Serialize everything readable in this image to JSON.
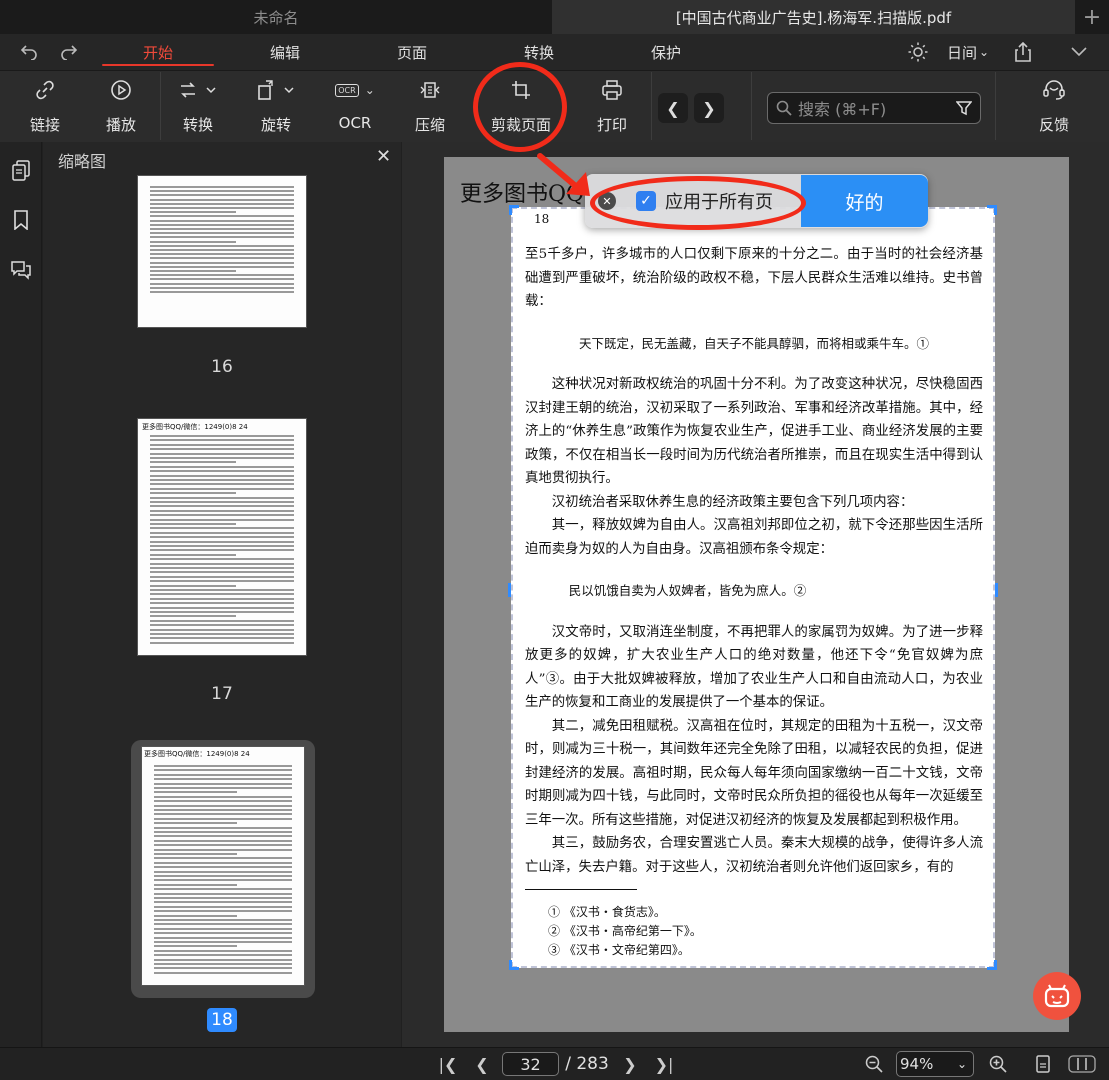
{
  "tabs": [
    {
      "label": "未命名"
    },
    {
      "label": "[中国古代商业广告史].杨海军.扫描版.pdf"
    }
  ],
  "tab_add": "+",
  "menu": {
    "start": "开始",
    "edit": "编辑",
    "page": "页面",
    "convert": "转换",
    "protect": "保护",
    "theme": "日间"
  },
  "toolbar": {
    "link": "链接",
    "play": "播放",
    "rotate_convert": "转换",
    "rotate": "旋转",
    "ocr": "OCR",
    "compress": "压缩",
    "crop": "剪裁页面",
    "print": "打印",
    "feedback": "反馈",
    "ocr_icon_text": "OCR",
    "search_placeholder": "搜索 (⌘+F)"
  },
  "sidebar": {
    "title": "缩略图",
    "close": "✕"
  },
  "thumbnails": [
    {
      "page": "16",
      "header": ""
    },
    {
      "page": "17",
      "header": "更多图书QQ/微信：1249(0)8 24"
    },
    {
      "page": "18",
      "header": "更多图书QQ/微信：1249(0)8 24"
    }
  ],
  "document": {
    "header_text": "更多图书QQ",
    "page_number": "18",
    "paragraphs": [
      "至5千多户，许多城市的人口仅剩下原来的十分之二。由于当时的社会经济基础遭到严重破坏，统治阶级的政权不稳，下层人民群众生活难以维持。史书曾载：",
      "天下既定，民无盖藏，自天子不能具醇驷，而将相或乘牛车。①",
      "这种状况对新政权统治的巩固十分不利。为了改变这种状况，尽快稳固西汉封建王朝的统治，汉初采取了一系列政治、军事和经济改革措施。其中，经济上的“休养生息”政策作为恢复农业生产，促进手工业、商业经济发展的主要政策，不仅在相当长一段时间为历代统治者所推崇，而且在现实生活中得到认真地贯彻执行。",
      "汉初统治者采取休养生息的经济政策主要包含下列几项内容：",
      "其一，释放奴婢为自由人。汉高祖刘邦即位之初，就下令还那些因生活所迫而卖身为奴的人为自由身。汉高祖颁布条令规定：",
      "民以饥饿自卖为人奴婢者，皆免为庶人。②",
      "汉文帝时，又取消连坐制度，不再把罪人的家属罚为奴婢。为了进一步释放更多的奴婢，扩大农业生产人口的绝对数量，他还下令“免官奴婢为庶人”③。由于大批奴婢被释放，增加了农业生产人口和自由流动人口，为农业生产的恢复和工商业的发展提供了一个基本的保证。",
      "其二，减免田租赋税。汉高祖在位时，其规定的田租为十五税一，汉文帝时，则减为三十税一，其间数年还完全免除了田租，以减轻农民的负担，促进封建经济的发展。高祖时期，民众每人每年须向国家缴纳一百二十文钱，文帝时期则减为四十钱，与此同时，文帝时民众所负担的徭役也从每年一次延缓至三年一次。所有这些措施，对促进汉初经济的恢复及发展都起到积极作用。",
      "其三，鼓励务农，合理安置逃亡人员。秦末大规模的战争，使得许多人流亡山泽，失去户籍。对于这些人，汉初统治者则允许他们返回家乡，有的"
    ],
    "footnotes": [
      "① 《汉书・食货志》。",
      "② 《汉书・高帝纪第一下》。",
      "③ 《汉书・文帝纪第四》。"
    ]
  },
  "popup": {
    "checkbox_label": "应用于所有页",
    "checked": true,
    "ok": "好的"
  },
  "bottombar": {
    "current_page": "32",
    "total_pages": "/ 283",
    "zoom": "94%"
  },
  "colors": {
    "accent": "#2b8ff5",
    "menu_active": "#f04a3a",
    "annotation": "#f12b1a"
  }
}
